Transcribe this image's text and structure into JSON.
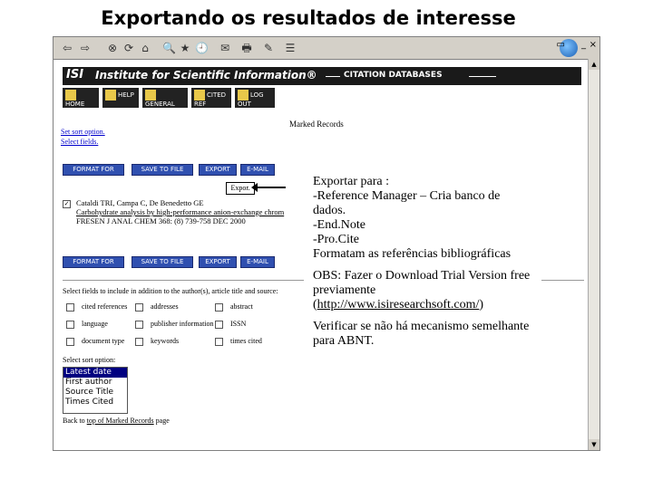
{
  "slide": {
    "title": "Exportando os resultados de interesse"
  },
  "browser": {
    "toolbar_buttons": [
      "⇦",
      "⇨",
      "⊗",
      "⟳",
      "⌂",
      "🔍",
      "★",
      "🕘",
      "✉",
      "🖶",
      "✎",
      "☰"
    ],
    "window_controls": [
      "▭",
      "_",
      "×"
    ]
  },
  "isi": {
    "logo": "ISI",
    "name": "Institute for Scientific Information®",
    "databases": "CITATION DATABASES",
    "nav": [
      {
        "label": "HOME"
      },
      {
        "label": "HELP"
      },
      {
        "label": "GENERAL SEARCH"
      },
      {
        "label": "CITED REF SEARCH"
      },
      {
        "label": "LOG OUT"
      }
    ]
  },
  "page": {
    "heading": "Marked Records",
    "link_sort": "Set sort option.",
    "link_fields": "Select fields.",
    "buttons": {
      "format": "FORMAT FOR PRINT",
      "save": "SAVE TO FILE",
      "export": "EXPORT",
      "email": "E-MAIL"
    },
    "tip": "Expor.",
    "record": {
      "check": "✓",
      "title": "Cataldi TRI, Campa C, De Benedetto GE",
      "desc": "Carbohydrate analysis by high-performance anion-exchange chrom",
      "source": "FRESEN J ANAL CHEM 368: (8) 739-758 DEC 2000"
    },
    "fields_heading": "Select fields to include in addition to the author(s), article title and source:",
    "fields": [
      [
        "cited references",
        "addresses",
        "abstract"
      ],
      [
        "language",
        "publisher information",
        "ISSN"
      ],
      [
        "document type",
        "keywords",
        "times cited"
      ]
    ],
    "sort_label": "Select sort option:",
    "sort_options": [
      "Latest date",
      "First author",
      "Source Title",
      "Times Cited"
    ],
    "sort_selected": "Latest date",
    "back_text": "Back to ",
    "back_link": "top of Marked Records",
    "back_suffix": " page"
  },
  "note": {
    "l1": "Exportar para :",
    "l2": "-Reference Manager – Cria banco de dados.",
    "l3": "-End.Note",
    "l4": "-Pro.Cite",
    "l5": "Formatam as referências bibliográficas",
    "l6": "OBS: Fazer o Download Trial Version free  previamente",
    "l7_open": "(",
    "l7_url": "http://www.isiresearchsoft.com/",
    "l7_close": ")",
    "l8": "Verificar se não há mecanismo semelhante para ABNT."
  }
}
